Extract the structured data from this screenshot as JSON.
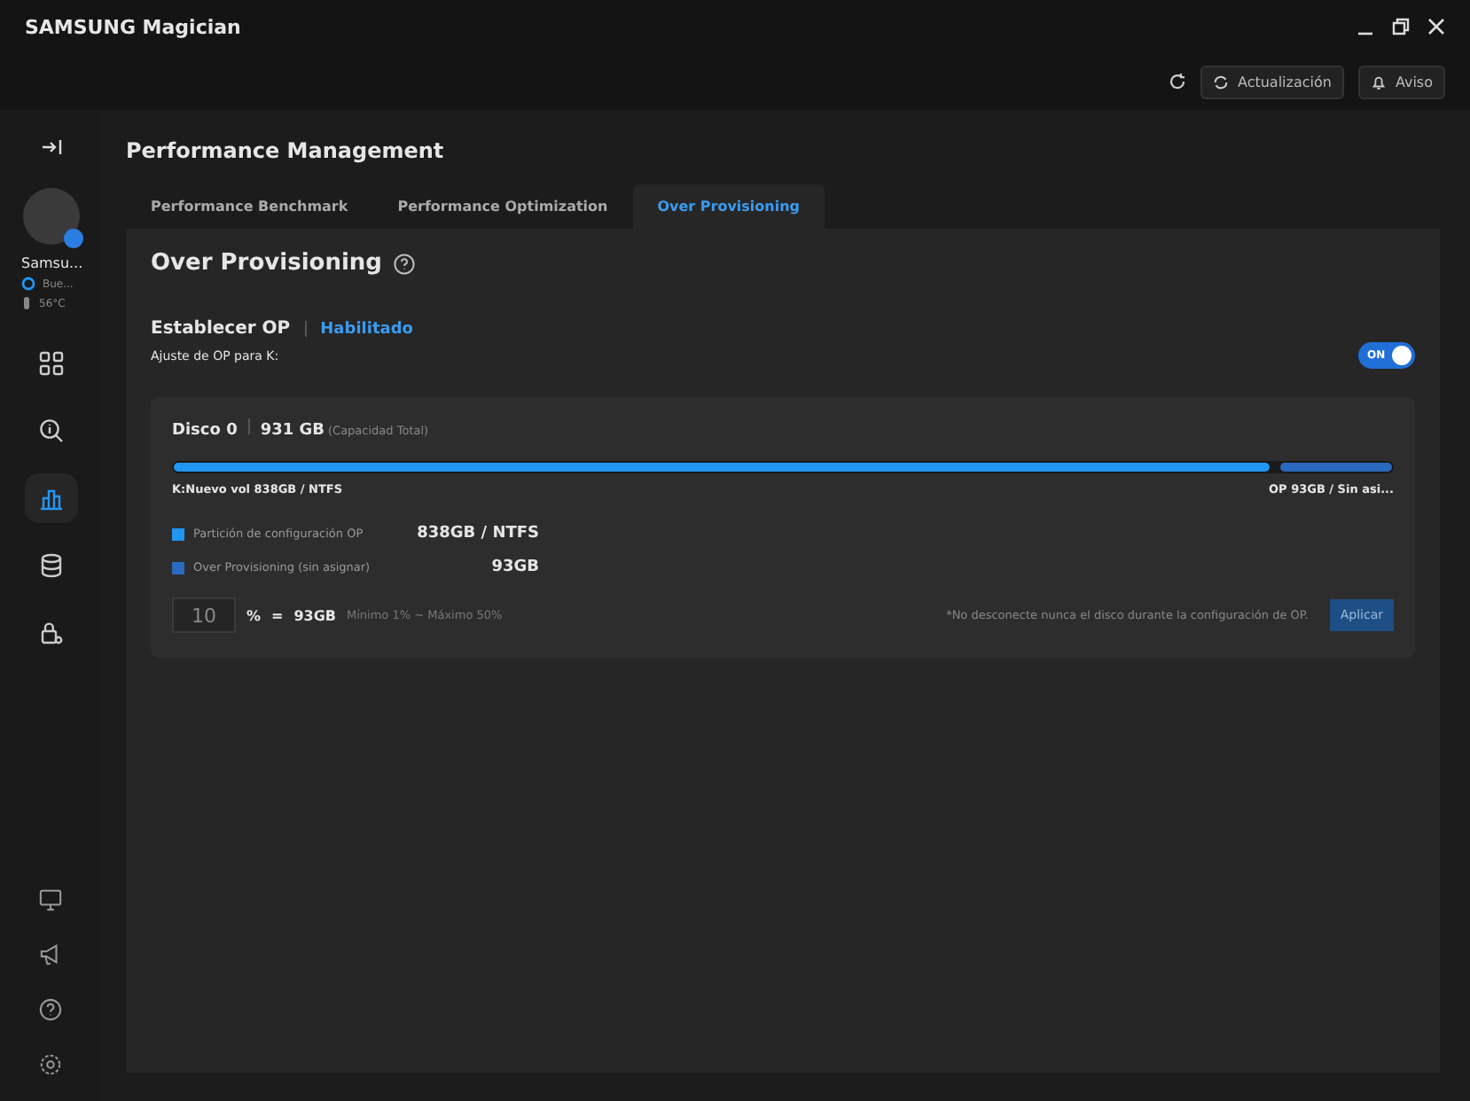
{
  "window": {
    "title": "SAMSUNG Magician"
  },
  "toolbar": {
    "update_label": "Actualización",
    "notice_label": "Aviso"
  },
  "sidebar": {
    "device": {
      "name": "Samsu...",
      "status": "Bue...",
      "temperature": "56°C"
    },
    "nav": [
      {
        "kind": "grid",
        "selected": false
      },
      {
        "kind": "search",
        "selected": false
      },
      {
        "kind": "chart",
        "selected": true
      },
      {
        "kind": "database",
        "selected": false
      },
      {
        "kind": "lock",
        "selected": false
      }
    ],
    "bottom": [
      {
        "kind": "monitor"
      },
      {
        "kind": "megaphone"
      },
      {
        "kind": "help"
      },
      {
        "kind": "settings"
      }
    ]
  },
  "page_title": "Performance Management",
  "tabs": [
    {
      "label": "Performance Benchmark",
      "selected": false
    },
    {
      "label": "Performance Optimization",
      "selected": false
    },
    {
      "label": "Over Provisioning",
      "selected": true
    }
  ],
  "section": {
    "title": "Over Provisioning",
    "op_label": "Establecer OP",
    "op_status": "Habilitado",
    "setting_label": "Ajuste de OP para K:",
    "toggle": {
      "label": "ON",
      "on": true
    }
  },
  "disk": {
    "name": "Disco 0",
    "capacity": "931 GB",
    "capacity_note": "(Capacidad Total)",
    "bar": {
      "level": 0.9
    },
    "left_label": "K:Nuevo vol 838GB / NTFS",
    "right_label": "OP 93GB / Sin asi...",
    "legend": [
      {
        "label": "Partición de configuración OP",
        "value": "838GB / NTFS",
        "color": "#2196f3"
      },
      {
        "label": "Over Provisioning (sin asignar)",
        "value": "93GB",
        "color": "#2a6ac0"
      }
    ],
    "percent_value": "10",
    "percent_sign": "%",
    "equals": "=",
    "result": "93GB",
    "range": "Mínimo 1% ~ Máximo 50%",
    "warning": "*No desconecte nunca el disco durante la configuración de OP.",
    "apply": "Aplicar"
  }
}
